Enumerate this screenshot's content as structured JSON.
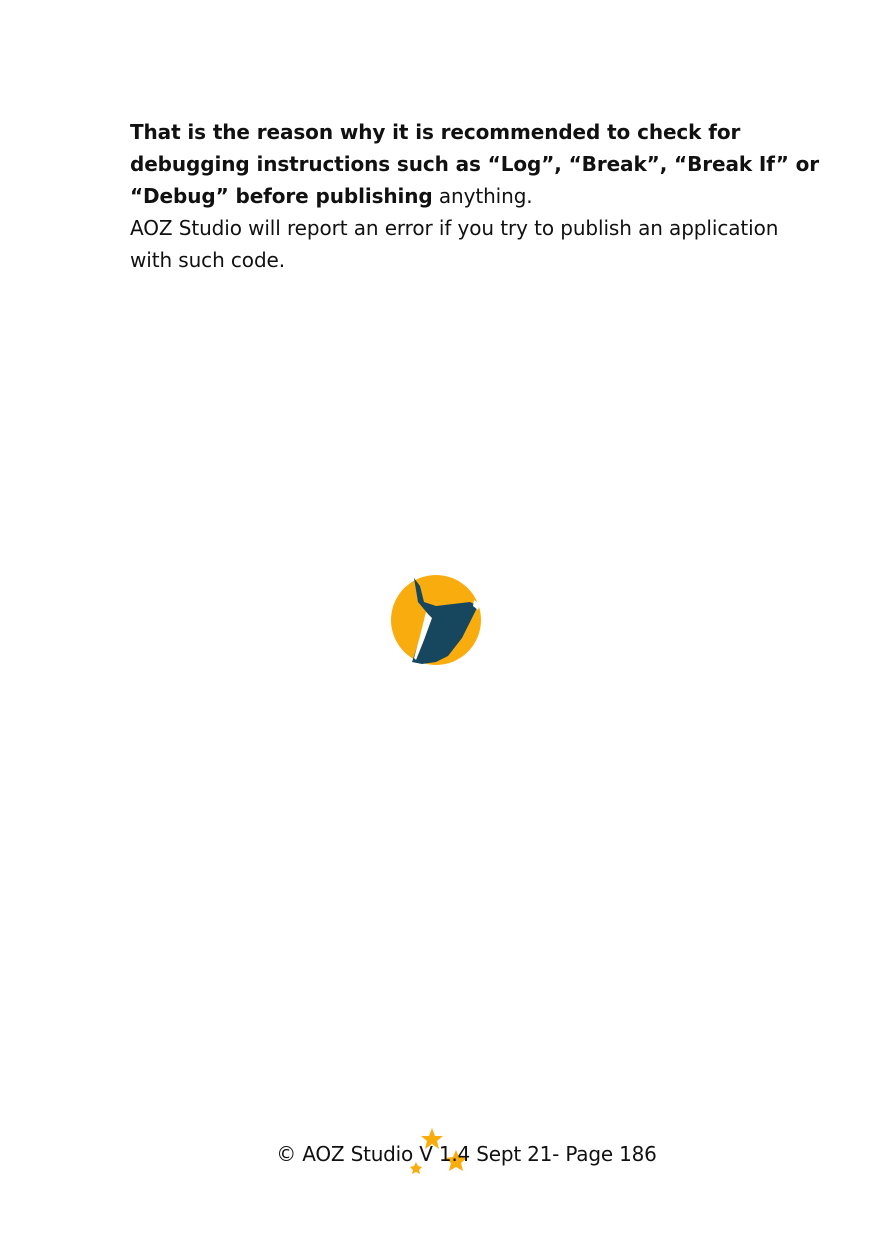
{
  "body": {
    "paragraph1_bold": "That is the reason why it is recommended to check for debugging instructions such as “Log”, “Break”, “Break If” or “Debug” before publishing",
    "paragraph1_rest": " anything.",
    "paragraph2": "AOZ Studio will report an error if you try to publish an application with such code."
  },
  "logo": {
    "icon": "aoz-studio-logo-icon",
    "colors": {
      "circle": "#F9AC0E",
      "shape": "#17475E"
    }
  },
  "footer": {
    "text": "© AOZ Studio V 1.4 Sept 21- Page 186",
    "decoration_icon": "stars-icon",
    "star_color": "#F9AC0E"
  }
}
